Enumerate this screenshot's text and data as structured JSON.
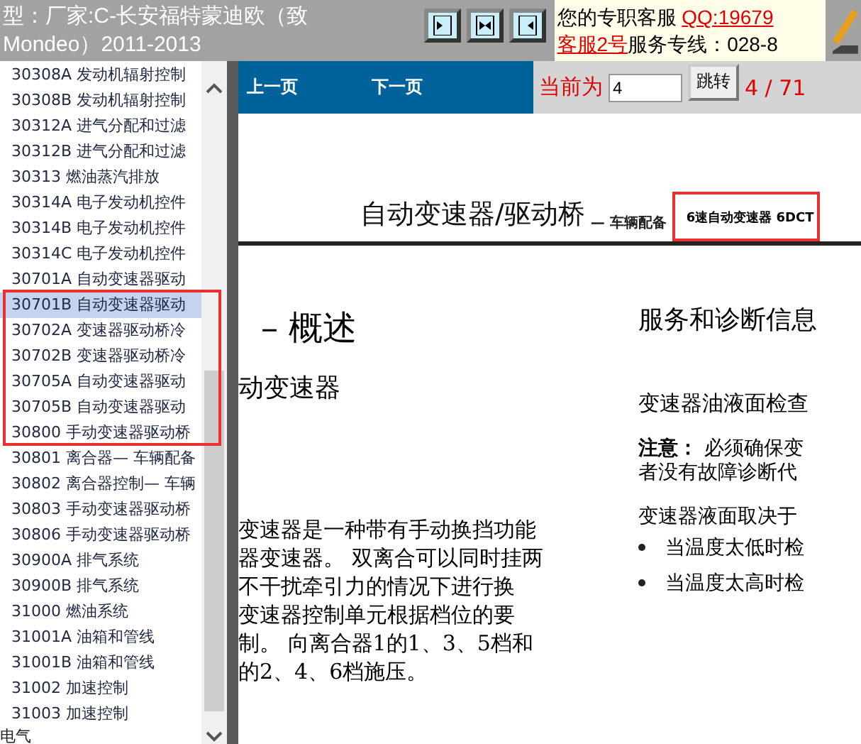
{
  "header": {
    "title": "型：厂家:C-长安福特蒙迪欧（致 Mondeo）2011-2013",
    "service_label": "您的专职客服",
    "qq": "QQ:19679",
    "service_2": "客服2号",
    "hotline": "服务专线：028-8"
  },
  "sidebar": {
    "items": [
      {
        "label": "30308A 发动机辐射控制",
        "selected": false
      },
      {
        "label": "30308B 发动机辐射控制",
        "selected": false
      },
      {
        "label": "30312A 进气分配和过滤",
        "selected": false
      },
      {
        "label": "30312B 进气分配和过滤",
        "selected": false
      },
      {
        "label": "30313 燃油蒸汽排放",
        "selected": false
      },
      {
        "label": "30314A 电子发动机控件",
        "selected": false
      },
      {
        "label": "30314B 电子发动机控件",
        "selected": false
      },
      {
        "label": "30314C 电子发动机控件",
        "selected": false
      },
      {
        "label": "30701A 自动变速器驱动",
        "selected": false
      },
      {
        "label": "30701B 自动变速器驱动",
        "selected": true
      },
      {
        "label": "30702A 变速器驱动桥冷",
        "selected": false
      },
      {
        "label": "30702B 变速器驱动桥冷",
        "selected": false
      },
      {
        "label": "30705A 自动变速器驱动",
        "selected": false
      },
      {
        "label": "30705B 自动变速器驱动",
        "selected": false
      },
      {
        "label": "30800 手动变速器驱动桥",
        "selected": false
      },
      {
        "label": "30801 离合器— 车辆配备",
        "selected": false
      },
      {
        "label": "30802 离合器控制— 车辆",
        "selected": false
      },
      {
        "label": "30803 手动变速器驱动桥",
        "selected": false
      },
      {
        "label": "30806 手动变速器驱动桥",
        "selected": false
      },
      {
        "label": "30900A 排气系统",
        "selected": false
      },
      {
        "label": "30900B 排气系统",
        "selected": false
      },
      {
        "label": "31000 燃油系统",
        "selected": false
      },
      {
        "label": "31001A 油箱和管线",
        "selected": false
      },
      {
        "label": "31001B 油箱和管线",
        "selected": false
      },
      {
        "label": "31002 加速控制",
        "selected": false
      },
      {
        "label": "31003 加速控制",
        "selected": false
      }
    ],
    "group_label": "电气"
  },
  "nav": {
    "prev": "上一页",
    "next": "下一页",
    "current_label": "当前为",
    "page_value": "4",
    "jump": "跳转",
    "page_count": "4 / 71"
  },
  "document": {
    "title": "自动变速器/驱动桥",
    "subtitle": "— 车辆配备",
    "tag": "6速自动变速器 6DCT",
    "section": "– 概述",
    "subsection": "动变速器",
    "left_lines": [
      "变速器是一种带有手动换挡功能",
      "器变速器。 双离合可以同时挂两",
      "不干扰牵引力的情况下进行换",
      "变速器控制单元根据档位的要",
      "制。 向离合器1的1、3、5档和",
      "的2、4、6档施压。"
    ],
    "right_heading": "服务和诊断信息",
    "right_subheading": "变速器油液面检查",
    "note_label": "注意：",
    "note_lines": [
      "必须确保变",
      "者没有故障诊断代"
    ],
    "body": "变速器液面取决于",
    "bullets": [
      "当温度太低时检",
      "当温度太高时检"
    ]
  }
}
